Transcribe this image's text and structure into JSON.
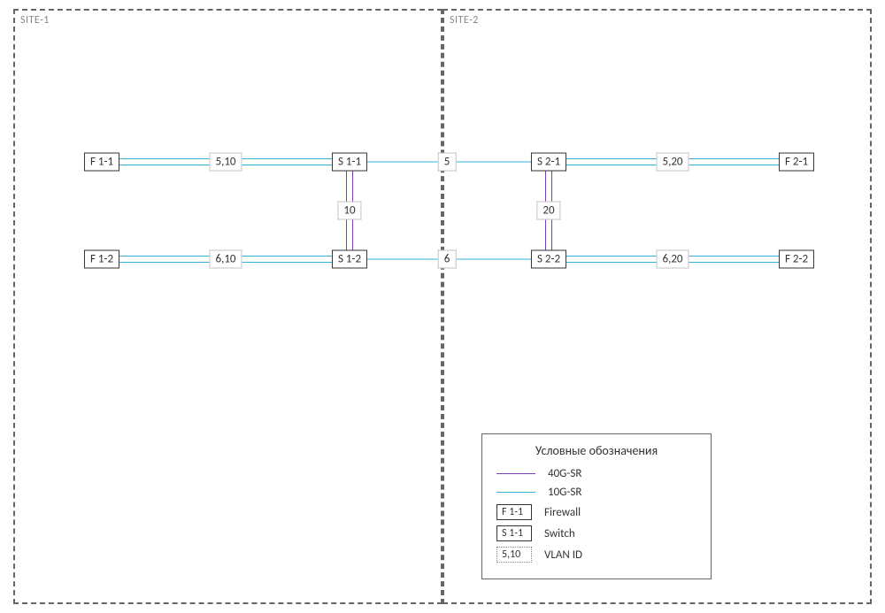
{
  "sites": {
    "site1": {
      "label": "SITE-1"
    },
    "site2": {
      "label": "SITE-2"
    }
  },
  "nodes": {
    "f11": "F 1-1",
    "f12": "F 1-2",
    "s11": "S 1-1",
    "s12": "S 1-2",
    "s21": "S 2-1",
    "s22": "S 2-2",
    "f21": "F 2-1",
    "f22": "F 2-2"
  },
  "vlans": {
    "v510": "5,10",
    "v610": "6,10",
    "v5": "5",
    "v6": "6",
    "v10": "10",
    "v20": "20",
    "v520": "5,20",
    "v620": "6,20"
  },
  "legend": {
    "title": "Условные обозначения",
    "link40g": "40G-SR",
    "link10g": "10G-SR",
    "firewall_sample": "F 1-1",
    "firewall_label": "Firewall",
    "switch_sample": "S 1-1",
    "switch_label": "Switch",
    "vlan_sample": "5,10",
    "vlan_label": "VLAN ID"
  }
}
